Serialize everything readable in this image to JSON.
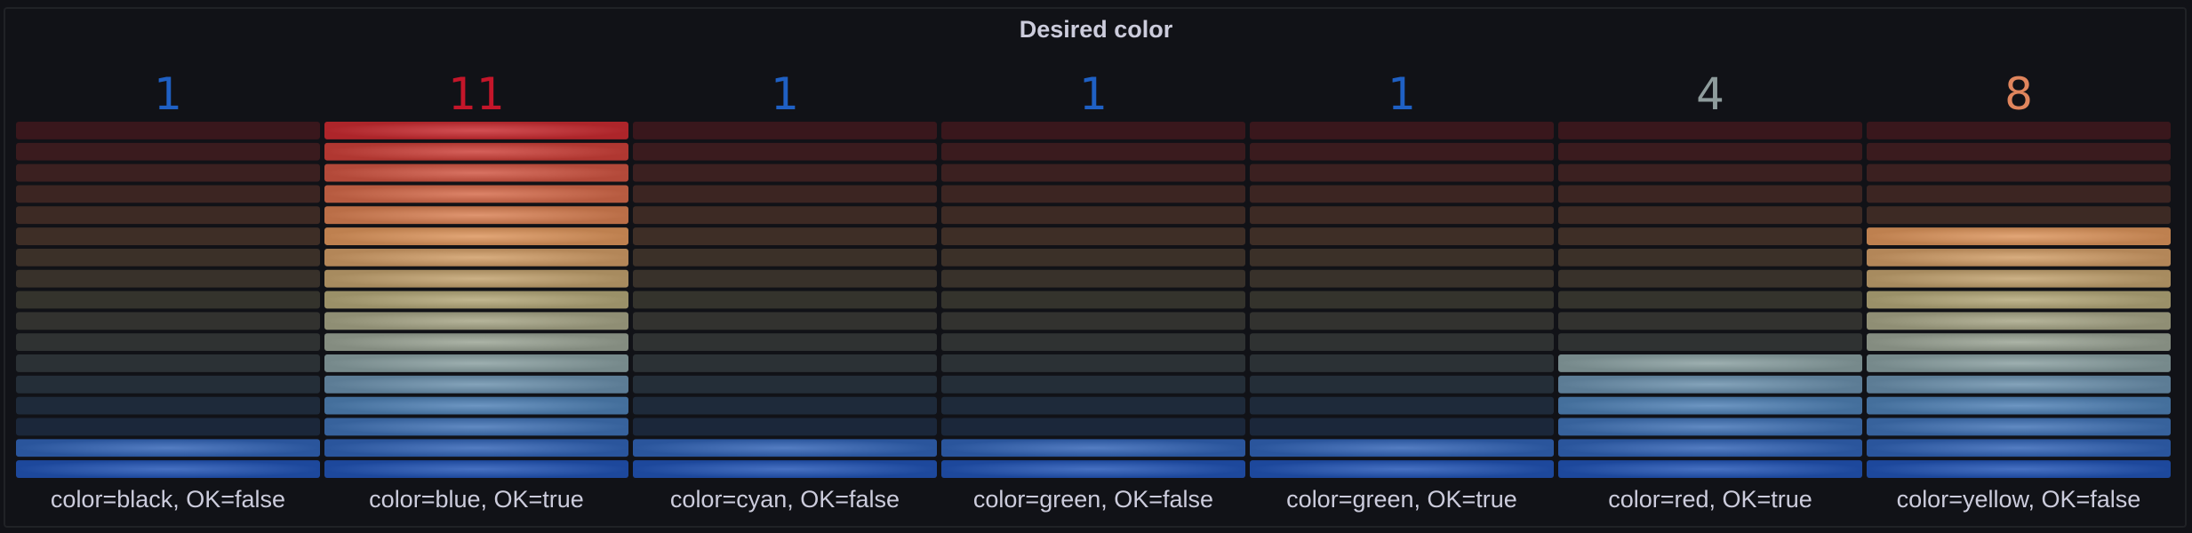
{
  "panel": {
    "title": "Desired color"
  },
  "chart_data": {
    "type": "bar",
    "style": "retro-lcd bar gauge",
    "orientation": "vertical",
    "categories": [
      "color=black, OK=false",
      "color=blue, OK=true",
      "color=cyan, OK=false",
      "color=green, OK=false",
      "color=green, OK=true",
      "color=red, OK=true",
      "color=yellow, OK=false"
    ],
    "values": [
      1,
      11,
      1,
      1,
      1,
      4,
      8
    ],
    "ylim": [
      0,
      11
    ],
    "cells": 17,
    "color_scheme": "blue-yellow-red gradient",
    "value_colors": [
      "#1f60c4",
      "#c4162a",
      "#1f60c4",
      "#1f60c4",
      "#1f60c4",
      "#8e9c9c",
      "#e0855d"
    ]
  }
}
